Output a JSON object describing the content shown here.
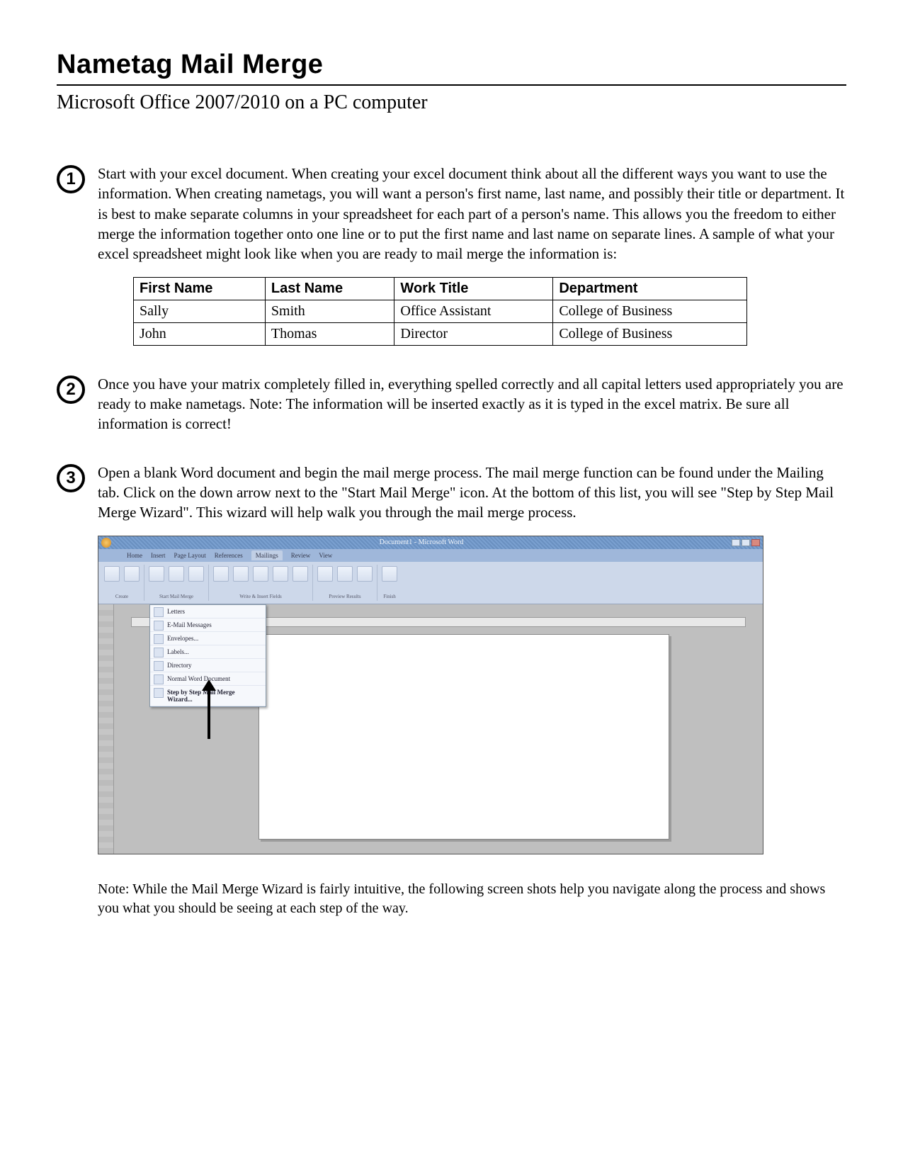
{
  "header": {
    "title": "Nametag Mail Merge",
    "subtitle": "Microsoft Office 2007/2010 on a PC computer"
  },
  "steps": [
    {
      "num": "1",
      "text": "Start with your excel document. When creating your excel document think about all the different ways you want to use the information. When creating nametags, you will want a person's first name, last name, and possibly their title or department. It is best to make separate columns in your spreadsheet for each part of a person's name. This allows you the freedom to either merge the information together onto one line or to put the first name and last name on separate lines. A sample of what your excel spreadsheet might look like when you are ready to mail merge the information is:"
    },
    {
      "num": "2",
      "text": "Once you have your matrix completely filled in, everything spelled correctly and all capital letters used appropriately you are ready to make nametags. Note: The information will be inserted exactly as it is typed in the excel matrix. Be sure all information is correct!"
    },
    {
      "num": "3",
      "text": "Open a blank Word document and begin the mail merge process. The mail merge function can be found under the Mailing tab. Click on the down arrow next to the \"Start Mail Merge\" icon. At the bottom of this list, you will see \"Step by Step Mail Merge Wizard\". This wizard will help walk you through the mail merge process."
    }
  ],
  "table": {
    "headers": [
      "First Name",
      "Last Name",
      "Work Title",
      "Department"
    ],
    "rows": [
      [
        "Sally",
        "Smith",
        "Office Assistant",
        "College of Business"
      ],
      [
        "John",
        "Thomas",
        "Director",
        "College of Business"
      ]
    ]
  },
  "word_screenshot": {
    "titlebar": "Document1 - Microsoft Word",
    "tabs": [
      "Home",
      "Insert",
      "Page Layout",
      "References",
      "Mailings",
      "Review",
      "View"
    ],
    "active_tab": "Mailings",
    "ribbon_groups": [
      "Create",
      "Start Mail Merge",
      "Write & Insert Fields",
      "Preview Results",
      "Finish"
    ],
    "dropdown_items": [
      "Letters",
      "E-Mail Messages",
      "Envelopes...",
      "Labels...",
      "Directory",
      "Normal Word Document",
      "Step by Step Mail Merge Wizard..."
    ]
  },
  "footer_note": "Note: While the Mail Merge Wizard is fairly intuitive, the following screen shots help you navigate along the process and shows you what you should be seeing at each step of the way."
}
